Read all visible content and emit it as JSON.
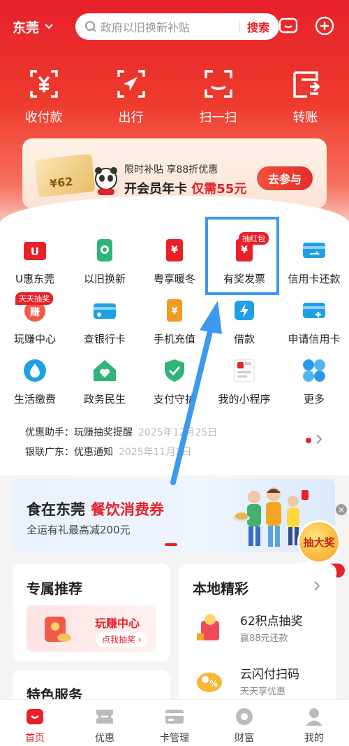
{
  "header": {
    "city": "东莞",
    "search_placeholder": "政府以旧换新补贴",
    "search_button": "搜索"
  },
  "quick_actions": [
    {
      "label": "收付款",
      "icon": "yuan-scan-icon"
    },
    {
      "label": "出行",
      "icon": "navigate-icon"
    },
    {
      "label": "扫一扫",
      "icon": "scan-icon"
    },
    {
      "label": "转账",
      "icon": "transfer-icon"
    }
  ],
  "promo": {
    "line1": "限时补贴 享88折优惠",
    "line2_prefix": "开会员年卡 ",
    "line2_highlight": "仅需55元",
    "card_amount": "¥62",
    "button": "去参与"
  },
  "services": [
    [
      {
        "label": "U惠东莞",
        "icon": "u-coupon-icon",
        "color": "#e8202a"
      },
      {
        "label": "以旧换新",
        "icon": "phone-trade-in-icon",
        "color": "#2fb47a"
      },
      {
        "label": "粤享暖冬",
        "icon": "yuan-voucher-icon",
        "color": "#e8202a"
      },
      {
        "label": "有奖发票",
        "icon": "invoice-icon",
        "color": "#e8202a",
        "tag": "抽红包"
      },
      {
        "label": "信用卡还款",
        "icon": "credit-card-repay-icon",
        "color": "#1ea0e6"
      }
    ],
    [
      {
        "label": "玩赚中心",
        "icon": "earn-icon",
        "color": "#e8202a",
        "tag": "天天抽奖"
      },
      {
        "label": "查银行卡",
        "icon": "bank-card-icon",
        "color": "#1ea0e6"
      },
      {
        "label": "手机充值",
        "icon": "phone-topup-icon",
        "color": "#f39a1e"
      },
      {
        "label": "借款",
        "icon": "loan-icon",
        "color": "#1ea0e6"
      },
      {
        "label": "申请信用卡",
        "icon": "apply-card-icon",
        "color": "#1ea0e6"
      }
    ],
    [
      {
        "label": "生活缴费",
        "icon": "water-drop-icon",
        "color": "#1ea0e6"
      },
      {
        "label": "政务民生",
        "icon": "gov-home-icon",
        "color": "#2fb47a"
      },
      {
        "label": "支付守护",
        "icon": "shield-icon",
        "color": "#2fb47a"
      },
      {
        "label": "我的小程序",
        "icon": "mini-program-icon",
        "color": "#e8202a"
      },
      {
        "label": "更多",
        "icon": "more-grid-icon",
        "color": "#1ea0e6"
      }
    ]
  ],
  "notices": [
    {
      "source": "优惠助手：",
      "text": "玩赚抽奖提醒",
      "date": "2025年12月25日"
    },
    {
      "source": "银联广东：",
      "text": "优惠通知",
      "date": "2025年11月3日"
    }
  ],
  "food_banner": {
    "title": "食在东莞",
    "highlight": "餐饮消费券",
    "subtitle": "全运有礼最高减200元"
  },
  "lottery": {
    "ball": "抽大奖",
    "label": "玩赚中心",
    "close": "×"
  },
  "exclusive": {
    "title": "专属推荐",
    "inner_title": "玩赚中心",
    "inner_button": "点我抽奖 ›"
  },
  "local": {
    "title": "本地精彩",
    "items": [
      {
        "title": "62积点抽奖",
        "subtitle": "赢88元还款"
      },
      {
        "title": "云闪付扫码",
        "subtitle": "天天享优惠"
      }
    ]
  },
  "special": {
    "title": "特色服务"
  },
  "tabbar": [
    {
      "label": "首页",
      "active": true
    },
    {
      "label": "优惠",
      "active": false
    },
    {
      "label": "卡管理",
      "active": false
    },
    {
      "label": "财富",
      "active": false
    },
    {
      "label": "我的",
      "active": false
    }
  ],
  "colors": {
    "brand": "#e8202a",
    "highlight_box": "#3c99f0"
  }
}
